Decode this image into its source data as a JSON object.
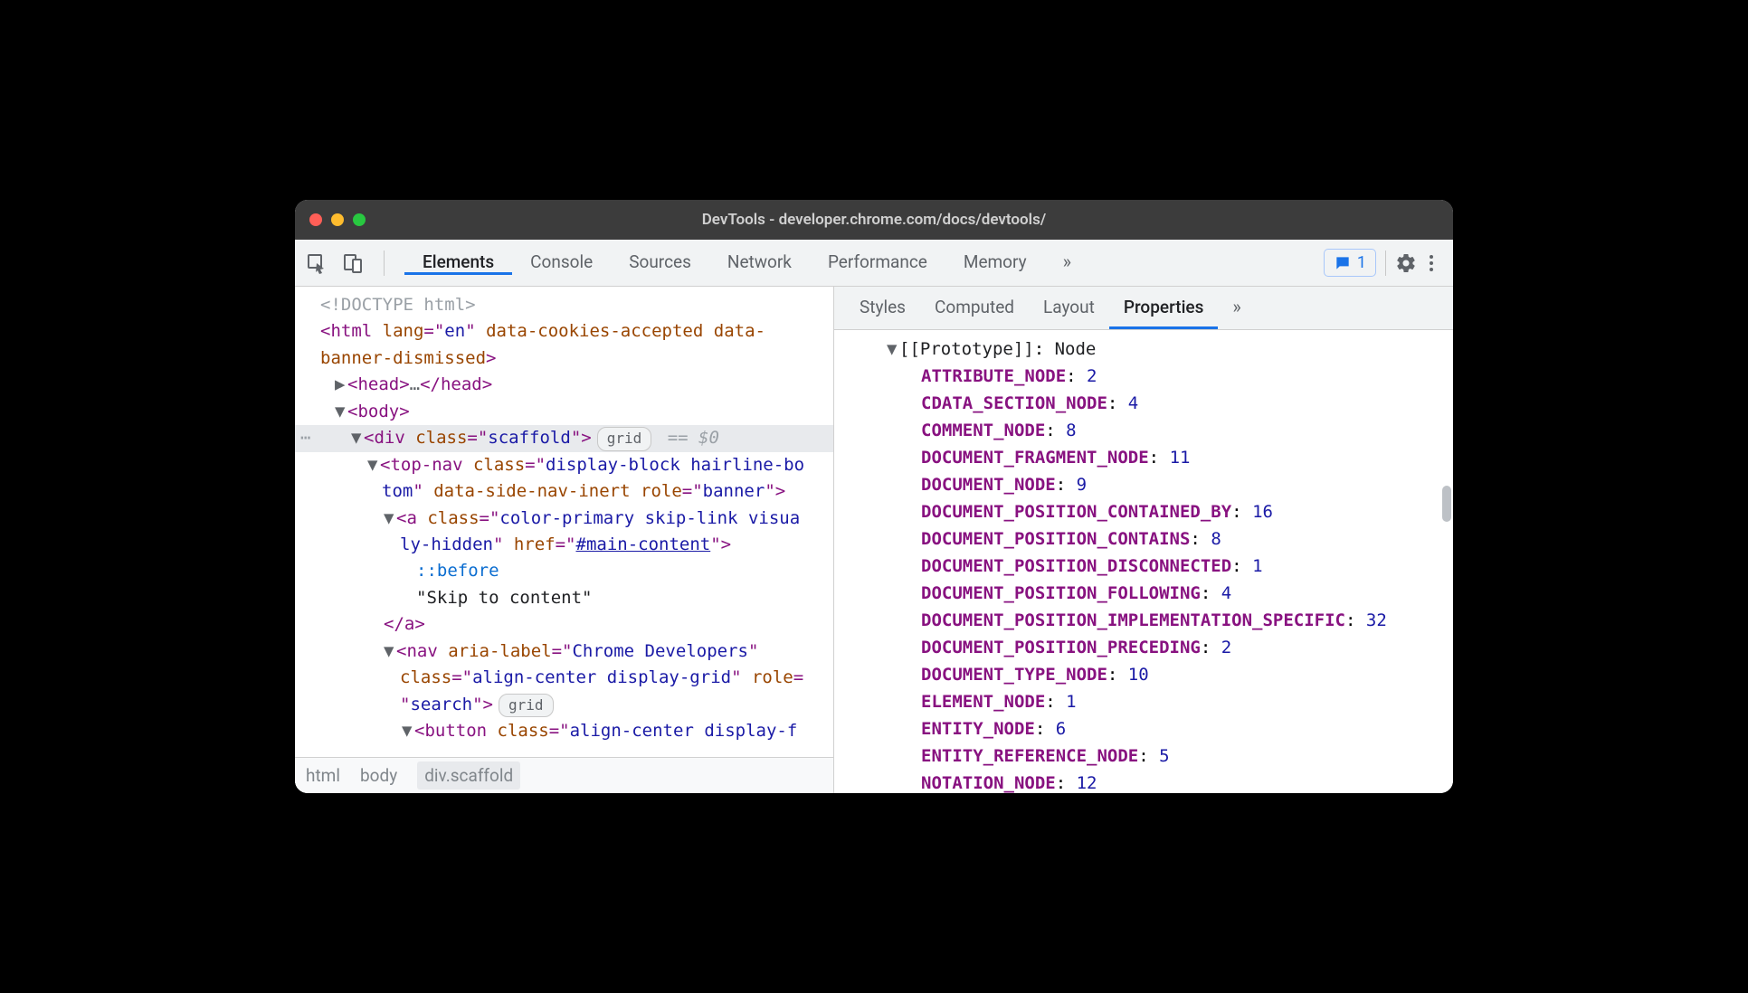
{
  "window": {
    "title": "DevTools - developer.chrome.com/docs/devtools/"
  },
  "toolbar": {
    "tabs": [
      "Elements",
      "Console",
      "Sources",
      "Network",
      "Performance",
      "Memory"
    ],
    "active_tab": "Elements",
    "overflow": "»",
    "issues_count": "1"
  },
  "dom": {
    "doctype": "<!DOCTYPE html>",
    "html_open_1": "<html lang=\"en\" data-cookies-accepted data-",
    "html_open_2": "banner-dismissed>",
    "head_ellipsis": "…",
    "body_tag": "body",
    "selected": {
      "tag": "div",
      "class_attr": "class",
      "class_val": "scaffold",
      "badge": "grid",
      "suffix": "== $0"
    },
    "topnav_1": "<top-nav class=\"display-block hairline-b",
    "topnav_2": "tom\" data-side-nav-inert role=\"banner\">",
    "a_1": "<a class=\"color-primary skip-link visua",
    "a_2_prefix": "ly-hidden\" href=\"",
    "a_href": "#main-content",
    "a_2_suffix": "\">",
    "pseudo_before": "::before",
    "skip_text": "\"Skip to content\"",
    "a_close": "</a>",
    "nav_1": "<nav aria-label=\"Chrome Developers\"",
    "nav_2": "class=\"align-center display-grid\" role=",
    "nav_3": "\"search\">",
    "nav_badge": "grid",
    "button_1": "<button class=\"align-center display-f"
  },
  "breadcrumbs": [
    "html",
    "body",
    "div.scaffold"
  ],
  "subtabs": {
    "tabs": [
      "Styles",
      "Computed",
      "Layout",
      "Properties"
    ],
    "active": "Properties",
    "overflow": "»"
  },
  "prototype": {
    "label": "[[Prototype]]",
    "value": "Node"
  },
  "properties": [
    {
      "key": "ATTRIBUTE_NODE",
      "val": "2"
    },
    {
      "key": "CDATA_SECTION_NODE",
      "val": "4"
    },
    {
      "key": "COMMENT_NODE",
      "val": "8"
    },
    {
      "key": "DOCUMENT_FRAGMENT_NODE",
      "val": "11"
    },
    {
      "key": "DOCUMENT_NODE",
      "val": "9"
    },
    {
      "key": "DOCUMENT_POSITION_CONTAINED_BY",
      "val": "16"
    },
    {
      "key": "DOCUMENT_POSITION_CONTAINS",
      "val": "8"
    },
    {
      "key": "DOCUMENT_POSITION_DISCONNECTED",
      "val": "1"
    },
    {
      "key": "DOCUMENT_POSITION_FOLLOWING",
      "val": "4"
    },
    {
      "key": "DOCUMENT_POSITION_IMPLEMENTATION_SPECIFIC",
      "val": "32"
    },
    {
      "key": "DOCUMENT_POSITION_PRECEDING",
      "val": "2"
    },
    {
      "key": "DOCUMENT_TYPE_NODE",
      "val": "10"
    },
    {
      "key": "ELEMENT_NODE",
      "val": "1"
    },
    {
      "key": "ENTITY_NODE",
      "val": "6"
    },
    {
      "key": "ENTITY_REFERENCE_NODE",
      "val": "5"
    },
    {
      "key": "NOTATION_NODE",
      "val": "12"
    }
  ]
}
